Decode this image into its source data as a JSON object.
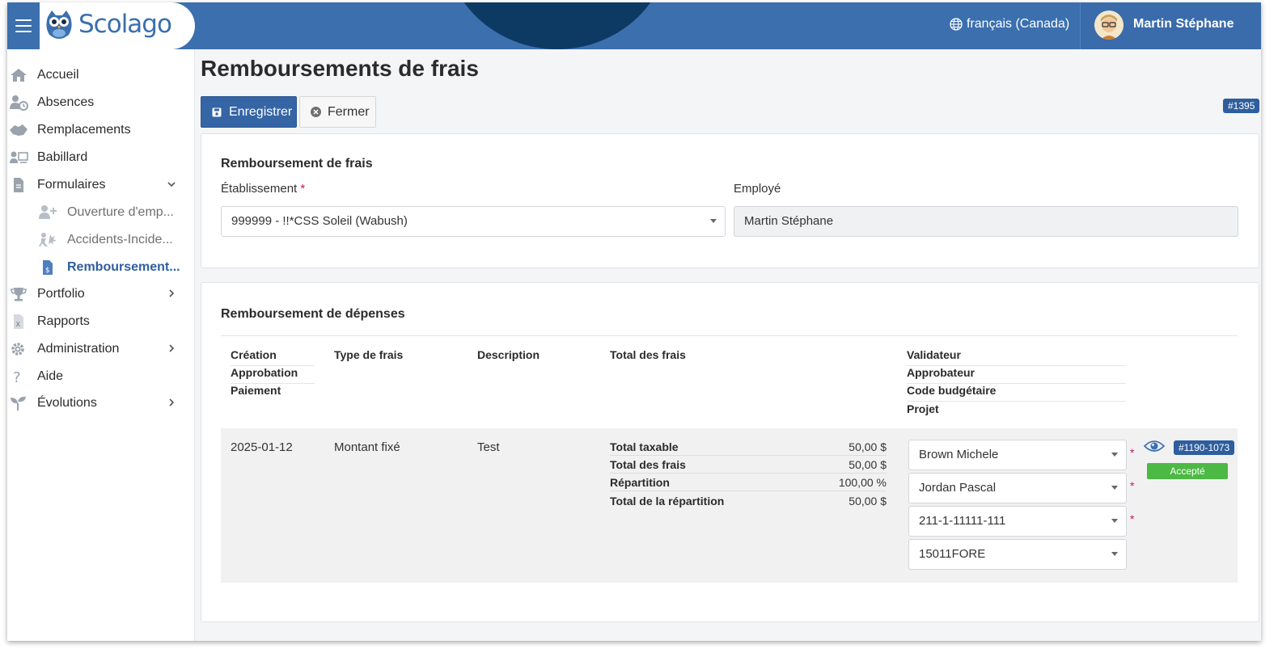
{
  "header": {
    "logo_text": "Scolago",
    "language": "français (Canada)",
    "user_name": "Martin Stéphane"
  },
  "sidebar": {
    "items": [
      {
        "label": "Accueil",
        "icon": "home-icon"
      },
      {
        "label": "Absences",
        "icon": "person-clock-icon"
      },
      {
        "label": "Remplacements",
        "icon": "handshake-icon"
      },
      {
        "label": "Babillard",
        "icon": "board-icon"
      },
      {
        "label": "Formulaires",
        "icon": "document-icon",
        "expanded": true
      },
      {
        "label": "Ouverture d'emp...",
        "icon": "user-plus-icon",
        "sub": true
      },
      {
        "label": "Accidents-Incide...",
        "icon": "accident-icon",
        "sub": true
      },
      {
        "label": "Remboursement...",
        "icon": "invoice-dollar-icon",
        "sub": true,
        "active": true
      },
      {
        "label": "Portfolio",
        "icon": "trophy-icon"
      },
      {
        "label": "Rapports",
        "icon": "excel-file-icon"
      },
      {
        "label": "Administration",
        "icon": "gear-icon"
      },
      {
        "label": "Aide",
        "icon": "question-icon"
      },
      {
        "label": "Évolutions",
        "icon": "sprout-icon"
      }
    ]
  },
  "page": {
    "title": "Remboursements de frais",
    "save_label": "Enregistrer",
    "close_label": "Fermer",
    "record_id": "#1395"
  },
  "form": {
    "section_title": "Remboursement de frais",
    "etablissement_label": "Établissement",
    "etablissement_required": "*",
    "etablissement_value": "999999 - !!*CSS Soleil (Wabush)",
    "employe_label": "Employé",
    "employe_value": "Martin Stéphane"
  },
  "expenses": {
    "section_title": "Remboursement de dépenses",
    "headers": {
      "dates": [
        "Création",
        "Approbation",
        "Paiement"
      ],
      "type": "Type de frais",
      "description": "Description",
      "total": "Total des frais",
      "people": [
        "Validateur",
        "Approbateur",
        "Code budgétaire",
        "Projet"
      ]
    },
    "row": {
      "date": "2025-01-12",
      "type": "Montant fixé",
      "description": "Test",
      "totals": [
        {
          "label": "Total taxable",
          "value": "50,00 $"
        },
        {
          "label": "Total des frais",
          "value": "50,00 $"
        },
        {
          "label": "Répartition",
          "value": "100,00 %"
        },
        {
          "label": "Total de la répartition",
          "value": "50,00 $"
        }
      ],
      "validateur": "Brown Michele",
      "approbateur": "Jordan Pascal",
      "code_budgetaire": "211-1-11111-111",
      "projet": "15011FORE",
      "required_mark": "*",
      "ref_tag": "#1190-1073",
      "status": "Accepté"
    }
  },
  "colors": {
    "primary": "#3b6fae",
    "dark_arc": "#0d3a63",
    "success": "#4cb944",
    "required": "#c2185b"
  }
}
